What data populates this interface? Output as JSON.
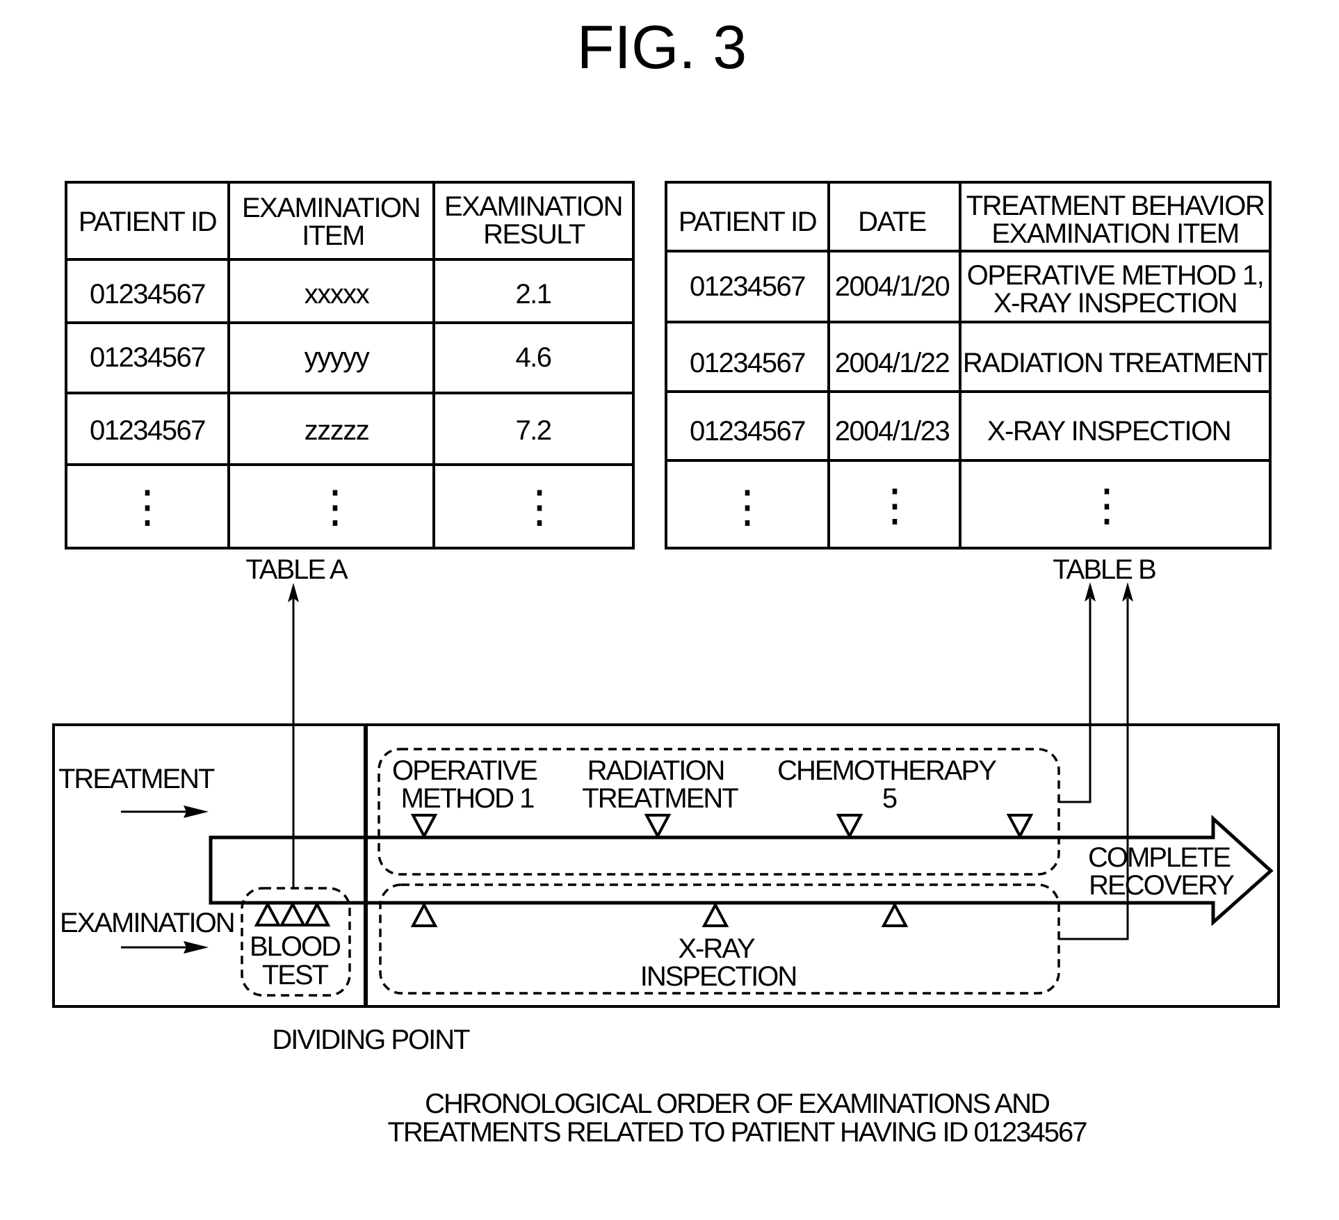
{
  "figure": {
    "title": "FIG. 3",
    "caption_lines": [
      "CHRONOLOGICAL ORDER OF EXAMINATIONS AND",
      "TREATMENTS RELATED TO PATIENT HAVING ID 01234567"
    ]
  },
  "table_a": {
    "label": "TABLE A",
    "headers": [
      [
        "PATIENT ID"
      ],
      [
        "EXAMINATION",
        "ITEM"
      ],
      [
        "EXAMINATION",
        "RESULT"
      ]
    ],
    "rows": [
      [
        "01234567",
        "xxxxx",
        "2.1"
      ],
      [
        "01234567",
        "yyyyy",
        "4.6"
      ],
      [
        "01234567",
        "zzzzz",
        "7.2"
      ]
    ],
    "continuation": "⋮"
  },
  "table_b": {
    "label": "TABLE B",
    "headers": [
      [
        "PATIENT ID"
      ],
      [
        "DATE"
      ],
      [
        "TREATMENT BEHAVIOR",
        "EXAMINATION ITEM"
      ]
    ],
    "rows": [
      [
        "01234567",
        "2004/1/20",
        [
          "OPERATIVE METHOD 1,",
          "X-RAY INSPECTION"
        ]
      ],
      [
        "01234567",
        "2004/1/22",
        [
          "RADIATION TREATMENT"
        ]
      ],
      [
        "01234567",
        "2004/1/23",
        [
          "X-RAY INSPECTION"
        ]
      ]
    ],
    "continuation": "⋮"
  },
  "timeline": {
    "row_labels": {
      "treatment": "TREATMENT",
      "examination": "EXAMINATION"
    },
    "dividing_point_label": "DIVIDING POINT",
    "end_label": [
      "COMPLETE",
      "RECOVERY"
    ],
    "blood_test_group": {
      "label": [
        "BLOOD",
        "TEST"
      ],
      "marker_count": 3,
      "links_to": "TABLE A"
    },
    "treatment_group": {
      "links_to": "TABLE B",
      "events": [
        {
          "label": [
            "OPERATIVE",
            "METHOD 1"
          ]
        },
        {
          "label": [
            "RADIATION",
            "TREATMENT"
          ]
        },
        {
          "label": [
            "CHEMOTHERAPY",
            "5"
          ]
        }
      ],
      "marker_count": 4
    },
    "xray_group": {
      "label": [
        "X-RAY",
        "INSPECTION"
      ],
      "marker_count": 3,
      "links_to": "TABLE B"
    }
  }
}
